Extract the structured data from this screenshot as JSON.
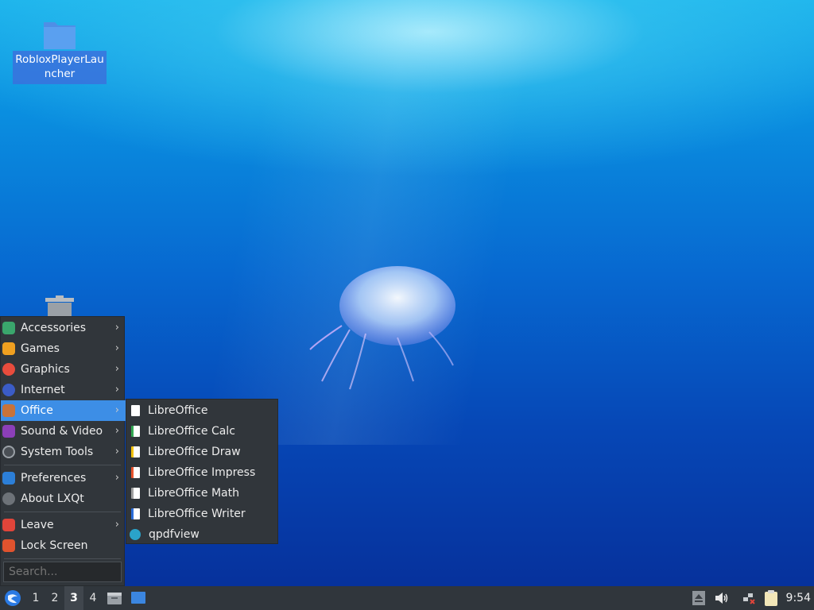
{
  "desktop": {
    "icons": [
      {
        "label": "RobloxPlayerLauncher",
        "label_line1": "RobloxPlayerLau",
        "label_line2": "ncher",
        "icon": "folder-icon"
      },
      {
        "label": "",
        "icon": "trash-icon"
      }
    ]
  },
  "start_menu": {
    "items": [
      {
        "label": "Accessories",
        "icon": "accessories-icon",
        "color": "#3aa66c"
      },
      {
        "label": "Games",
        "icon": "games-icon",
        "color": "#f0a020"
      },
      {
        "label": "Graphics",
        "icon": "graphics-icon",
        "color": "#e84c3d"
      },
      {
        "label": "Internet",
        "icon": "internet-icon",
        "color": "#3b5cc6"
      },
      {
        "label": "Office",
        "icon": "office-icon",
        "color": "#c8733a"
      },
      {
        "label": "Sound & Video",
        "icon": "sound-video-icon",
        "color": "#8c3fb8"
      },
      {
        "label": "System Tools",
        "icon": "system-tools-icon",
        "color": "#4a4f55"
      },
      {
        "label": "Preferences",
        "icon": "preferences-icon",
        "color": "#2c7fd8"
      },
      {
        "label": "About LXQt",
        "icon": "about-icon",
        "color": "#6d7278"
      },
      {
        "label": "Leave",
        "icon": "power-icon",
        "color": "#e0453a"
      },
      {
        "label": "Lock Screen",
        "icon": "lock-icon",
        "color": "#e0532e"
      }
    ],
    "search_placeholder": "Search..."
  },
  "office_submenu": {
    "items": [
      {
        "label": "LibreOffice",
        "icon": "libreoffice-icon",
        "color": "#ffffff"
      },
      {
        "label": "LibreOffice Calc",
        "icon": "libreoffice-calc-icon",
        "color": "#33a853"
      },
      {
        "label": "LibreOffice Draw",
        "icon": "libreoffice-draw-icon",
        "color": "#f4c20d"
      },
      {
        "label": "LibreOffice Impress",
        "icon": "libreoffice-impress-icon",
        "color": "#e8532d"
      },
      {
        "label": "LibreOffice Math",
        "icon": "libreoffice-math-icon",
        "color": "#a0a0a0"
      },
      {
        "label": "LibreOffice Writer",
        "icon": "libreoffice-writer-icon",
        "color": "#2b6cd8"
      },
      {
        "label": "qpdfview",
        "icon": "qpdfview-icon",
        "color": "#2aa3c9"
      }
    ]
  },
  "taskbar": {
    "desktops": [
      "1",
      "2",
      "3",
      "4"
    ],
    "active_desktop": "3",
    "clock": "9:54"
  },
  "colors": {
    "panel_bg": "#30363c",
    "menu_bg": "#31363b",
    "highlight": "#3d8ee6"
  }
}
